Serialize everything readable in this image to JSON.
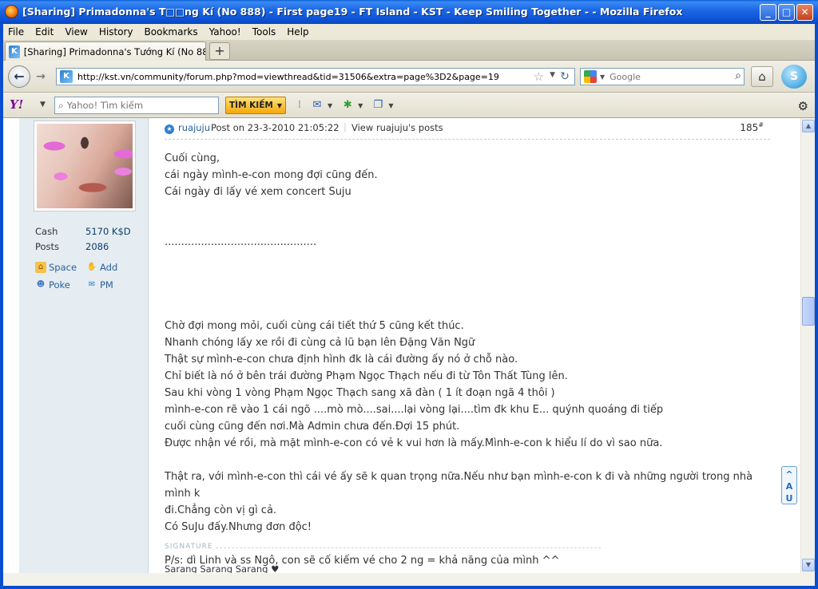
{
  "window": {
    "title": "[Sharing] Primadonna's T□□ng Kí (No 888) - First page19 - FT Island - KST - Keep Smiling Together - - Mozilla Firefox"
  },
  "menu": [
    "File",
    "Edit",
    "View",
    "History",
    "Bookmarks",
    "Yahoo!",
    "Tools",
    "Help"
  ],
  "tab": {
    "label": "[Sharing] Primadonna's Tướng Kí (No 888) - ...",
    "new_tab_label": "+"
  },
  "nav": {
    "url": "http://kst.vn/community/forum.php?mod=viewthread&tid=31506&extra=page%3D2&page=19",
    "search_placeholder": "Google"
  },
  "yahoo": {
    "logo": "Y!",
    "search_placeholder": "Yahoo! Tìm kiếm",
    "search_button": "TÌM KIẾM"
  },
  "user": {
    "stats": [
      {
        "label": "Cash",
        "value": "5170 K$D"
      },
      {
        "label": "Posts",
        "value": "2086"
      }
    ],
    "links": {
      "space": "Space",
      "add": "Add",
      "poke": "Poke",
      "pm": "PM"
    }
  },
  "post": {
    "author": "ruajuju",
    "meta": "Post on 23-3-2010 21:05:22",
    "separator": "|",
    "view_posts": "View ruajuju's posts",
    "number": "185",
    "number_sup": "#",
    "body": [
      "Cuối cùng,",
      "cái ngày mình-e-con mong đợi cũng đến.",
      "Cái ngày đi lấy vé xem concert Suju",
      "",
      "",
      "..............................................",
      "",
      "",
      "",
      "",
      "Chờ đợi mong mỏi, cuối cùng cái tiết thứ 5 cũng kết thúc.",
      "Nhanh chóng lấy xe rồi đi cùng cả lũ bạn lên Đặng Văn Ngữ",
      "Thật sự mình-e-con chưa định hình đk là cái đường ấy nó ở chỗ nào.",
      "Chỉ biết là nó ở bên trái đường Phạm Ngọc Thạch nếu đi từ Tôn Thất Tùng lên.",
      "Sau khi vòng 1 vòng Phạm Ngọc Thạch sang xã đàn ( 1 ít đoạn ngã 4 thôi )",
      "mình-e-con rẽ vào 1 cái ngõ ....mò mò....sai....lại vòng lại....tìm đk khu E... quýnh quoáng đi tiếp",
      "cuối cùng cũng đến nơi.Mà Admin chưa đến.Đợi 15 phút.",
      "Được nhận vé rồi, mà mặt mình-e-con có vẻ k vui hơn là mấy.Mình-e-con k hiểu lí do vì sao nữa.",
      "",
      "Thật ra, với mình-e-con thì cái vé ấy sẽ k quan trọng nữa.Nếu như bạn mình-e-con k đi và những người trong nhà mình k",
      "đi.Chẳng còn vị gì cả.",
      "Có SuJu đấy.Nhưng đơn độc!",
      "",
      "P/s: dì Linh và ss Ngô, con sẽ cố kiếm vé cho 2 ng = khả năng của mình ^^"
    ],
    "signature_label": "SIGNATURE",
    "signature": "Sarang Sarang Sarang ♥"
  }
}
